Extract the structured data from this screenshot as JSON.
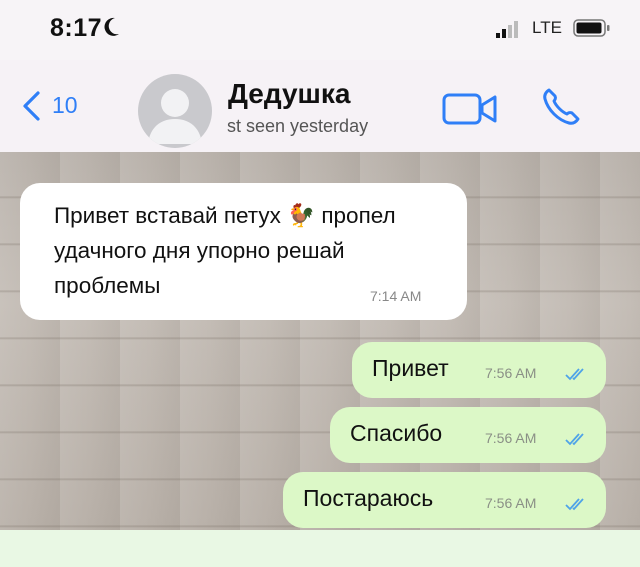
{
  "status_bar": {
    "time": "8:17",
    "network": "LTE",
    "moon_icon": "moon-icon",
    "signal_icon": "signal-icon",
    "battery_icon": "battery-icon"
  },
  "header": {
    "back_count": "10",
    "contact_name": "Дедушка",
    "last_seen": "st seen yesterday",
    "colors": {
      "accent": "#2f7ff7"
    }
  },
  "messages": [
    {
      "direction": "incoming",
      "text": "Привет вставай петух 🐓 пропел удачного дня упорно решай проблемы",
      "time": "7:14 AM"
    },
    {
      "direction": "outgoing",
      "text": "Привет",
      "time": "7:56 AM",
      "read": true
    },
    {
      "direction": "outgoing",
      "text": "Спасибо",
      "time": "7:56 AM",
      "read": true
    },
    {
      "direction": "outgoing",
      "text": "Постараюсь",
      "time": "7:56 AM",
      "read": true
    }
  ],
  "colors": {
    "outgoing_bubble": "#dcf8c7",
    "incoming_bubble": "#ffffff",
    "read_ticks": "#4fa3e8"
  }
}
